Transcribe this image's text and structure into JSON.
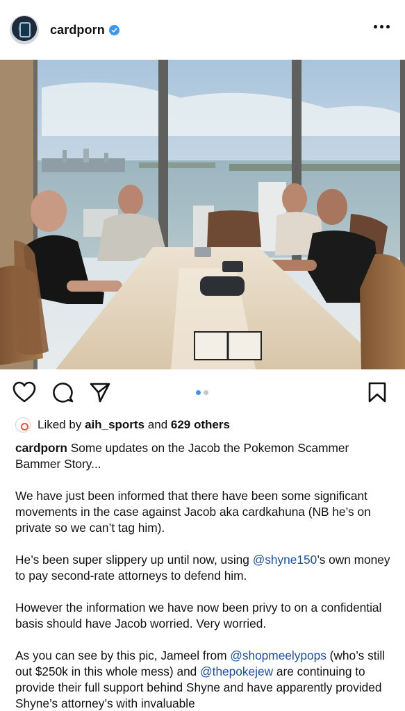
{
  "post": {
    "username": "cardporn",
    "verified": true
  },
  "icons": {
    "more": "more-horizontal-icon",
    "like": "heart-icon",
    "comment": "comment-icon",
    "share": "send-icon",
    "save": "bookmark-icon",
    "verified": "verified-badge-icon"
  },
  "carousel": {
    "count": 2,
    "active_index": 0
  },
  "likes": {
    "prefix": "Liked by",
    "user": "aih_sports",
    "middle": "and",
    "count": "629 others"
  },
  "caption": {
    "p1_rest": " Some updates on the Jacob the Pokemon Scammer Bammer Story...",
    "p2": "We have just been informed that there have been some significant movements in the case against Jacob aka cardkahuna (NB he’s on private so we can’t tag him).",
    "p3_a": "He’s been super slippery up until now, using ",
    "p3_mention": "@shyne150",
    "p3_b": "’s own money to pay second-rate attorneys to defend him.",
    "p4": "However the information we have now been privy to on a confidential basis should have Jacob worried. Very worried.",
    "p5_a": "As you can see by this pic, Jameel from ",
    "p5_mention1": "@shopmeelypops",
    "p5_b": " (who’s still out $250k in this whole mess) and ",
    "p5_mention2": "@thepokejew",
    "p5_c": " are continuing to provide their full support behind Shyne and have apparently provided Shyne’s attorney’s with invaluable"
  },
  "colors": {
    "accent_blue": "#3897f0",
    "mention": "#1b4f93",
    "text": "#111111"
  }
}
